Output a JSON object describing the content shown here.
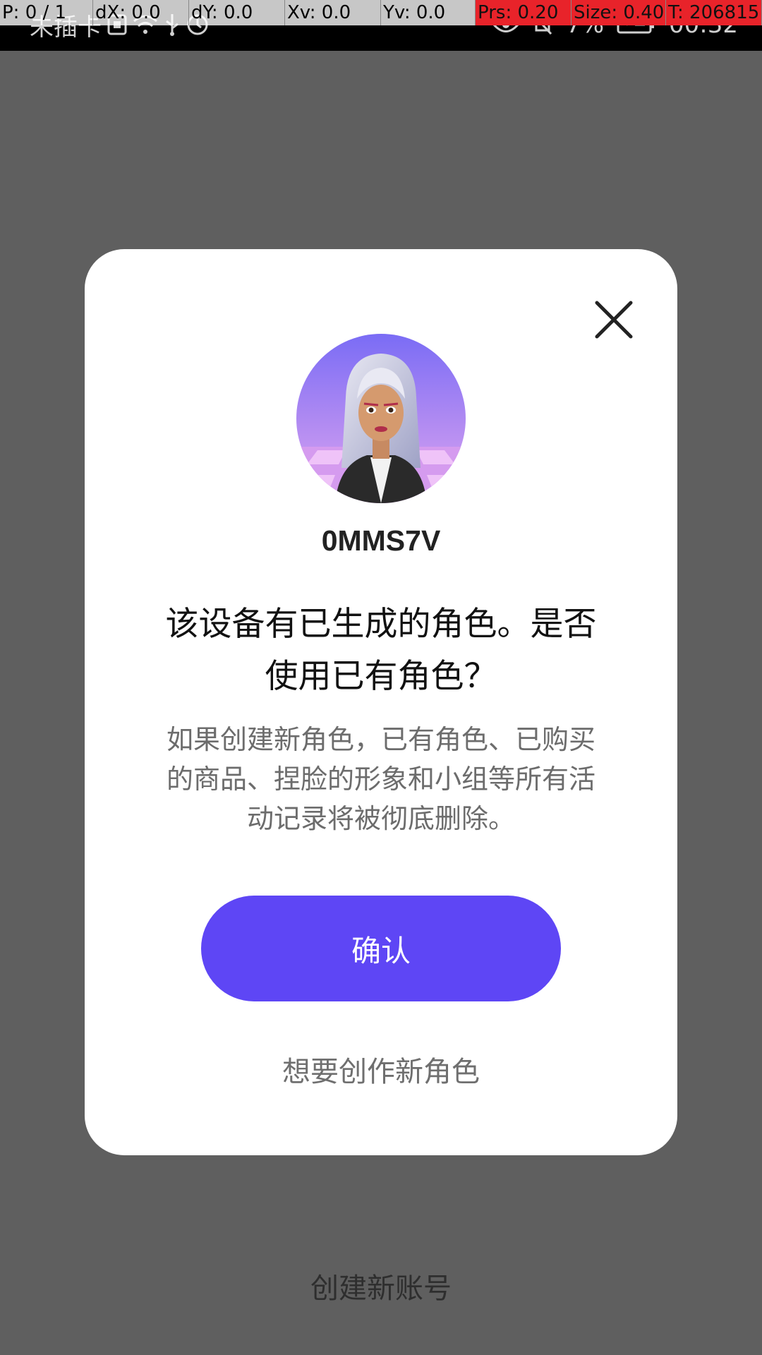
{
  "debug_overlay": {
    "pointer": "P: 0 / 1",
    "dx": "dX: 0.0",
    "dy": "dY: 0.0",
    "xv": "Xv: 0.0",
    "yv": "Yv: 0.0",
    "prs": "Prs: 0.20",
    "size": "Size: 0.40",
    "time": "T: 206815"
  },
  "status_bar": {
    "carrier": "未插卡",
    "battery_percent": "7%",
    "clock": "00:32",
    "icons_left": [
      "sim-icon",
      "wifi-icon",
      "usb-icon",
      "alarm-icon"
    ],
    "icons_right": [
      "eye-icon",
      "bell-off-icon",
      "battery-icon"
    ]
  },
  "dialog": {
    "username": "0MMS7V",
    "title_line1": "该设备有已生成的角色。是否",
    "title_line2": "使用已有角色？",
    "desc_line1": "如果创建新角色，已有角色、已购买",
    "desc_line2": "的商品、捏脸的形象和小组等所有活",
    "desc_line3": "动记录将被彻底删除。",
    "confirm_label": "确认",
    "new_role_label": "想要创作新角色",
    "accent_color": "#5e46f5"
  },
  "background": {
    "create_account_label": "创建新账号"
  }
}
